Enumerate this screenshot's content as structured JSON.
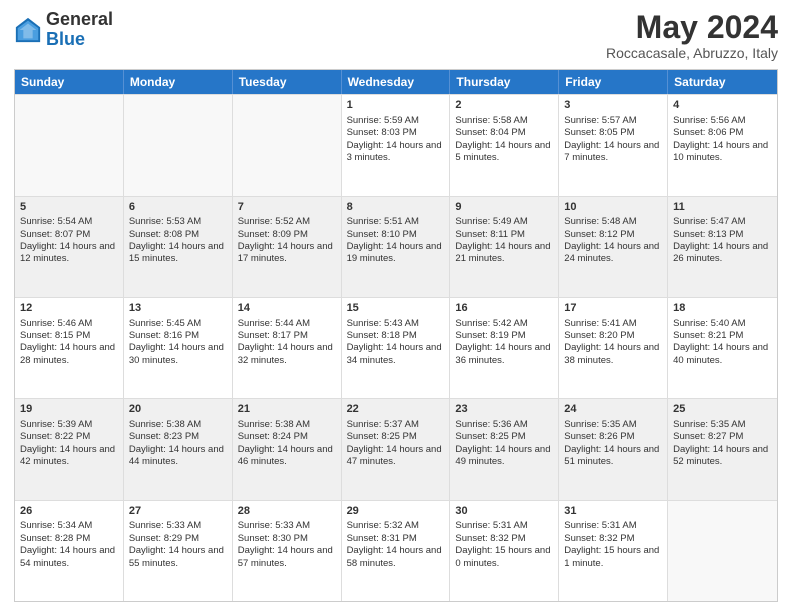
{
  "header": {
    "logo_line1": "General",
    "logo_line2": "Blue",
    "month": "May 2024",
    "location": "Roccacasale, Abruzzo, Italy"
  },
  "days": [
    "Sunday",
    "Monday",
    "Tuesday",
    "Wednesday",
    "Thursday",
    "Friday",
    "Saturday"
  ],
  "weeks": [
    [
      {
        "day": "",
        "empty": true
      },
      {
        "day": "",
        "empty": true
      },
      {
        "day": "",
        "empty": true
      },
      {
        "day": "1",
        "rise": "5:59 AM",
        "set": "8:03 PM",
        "daylight": "14 hours and 3 minutes."
      },
      {
        "day": "2",
        "rise": "5:58 AM",
        "set": "8:04 PM",
        "daylight": "14 hours and 5 minutes."
      },
      {
        "day": "3",
        "rise": "5:57 AM",
        "set": "8:05 PM",
        "daylight": "14 hours and 7 minutes."
      },
      {
        "day": "4",
        "rise": "5:56 AM",
        "set": "8:06 PM",
        "daylight": "14 hours and 10 minutes."
      }
    ],
    [
      {
        "day": "5",
        "rise": "5:54 AM",
        "set": "8:07 PM",
        "daylight": "14 hours and 12 minutes."
      },
      {
        "day": "6",
        "rise": "5:53 AM",
        "set": "8:08 PM",
        "daylight": "14 hours and 15 minutes."
      },
      {
        "day": "7",
        "rise": "5:52 AM",
        "set": "8:09 PM",
        "daylight": "14 hours and 17 minutes."
      },
      {
        "day": "8",
        "rise": "5:51 AM",
        "set": "8:10 PM",
        "daylight": "14 hours and 19 minutes."
      },
      {
        "day": "9",
        "rise": "5:49 AM",
        "set": "8:11 PM",
        "daylight": "14 hours and 21 minutes."
      },
      {
        "day": "10",
        "rise": "5:48 AM",
        "set": "8:12 PM",
        "daylight": "14 hours and 24 minutes."
      },
      {
        "day": "11",
        "rise": "5:47 AM",
        "set": "8:13 PM",
        "daylight": "14 hours and 26 minutes."
      }
    ],
    [
      {
        "day": "12",
        "rise": "5:46 AM",
        "set": "8:15 PM",
        "daylight": "14 hours and 28 minutes."
      },
      {
        "day": "13",
        "rise": "5:45 AM",
        "set": "8:16 PM",
        "daylight": "14 hours and 30 minutes."
      },
      {
        "day": "14",
        "rise": "5:44 AM",
        "set": "8:17 PM",
        "daylight": "14 hours and 32 minutes."
      },
      {
        "day": "15",
        "rise": "5:43 AM",
        "set": "8:18 PM",
        "daylight": "14 hours and 34 minutes."
      },
      {
        "day": "16",
        "rise": "5:42 AM",
        "set": "8:19 PM",
        "daylight": "14 hours and 36 minutes."
      },
      {
        "day": "17",
        "rise": "5:41 AM",
        "set": "8:20 PM",
        "daylight": "14 hours and 38 minutes."
      },
      {
        "day": "18",
        "rise": "5:40 AM",
        "set": "8:21 PM",
        "daylight": "14 hours and 40 minutes."
      }
    ],
    [
      {
        "day": "19",
        "rise": "5:39 AM",
        "set": "8:22 PM",
        "daylight": "14 hours and 42 minutes."
      },
      {
        "day": "20",
        "rise": "5:38 AM",
        "set": "8:23 PM",
        "daylight": "14 hours and 44 minutes."
      },
      {
        "day": "21",
        "rise": "5:38 AM",
        "set": "8:24 PM",
        "daylight": "14 hours and 46 minutes."
      },
      {
        "day": "22",
        "rise": "5:37 AM",
        "set": "8:25 PM",
        "daylight": "14 hours and 47 minutes."
      },
      {
        "day": "23",
        "rise": "5:36 AM",
        "set": "8:25 PM",
        "daylight": "14 hours and 49 minutes."
      },
      {
        "day": "24",
        "rise": "5:35 AM",
        "set": "8:26 PM",
        "daylight": "14 hours and 51 minutes."
      },
      {
        "day": "25",
        "rise": "5:35 AM",
        "set": "8:27 PM",
        "daylight": "14 hours and 52 minutes."
      }
    ],
    [
      {
        "day": "26",
        "rise": "5:34 AM",
        "set": "8:28 PM",
        "daylight": "14 hours and 54 minutes."
      },
      {
        "day": "27",
        "rise": "5:33 AM",
        "set": "8:29 PM",
        "daylight": "14 hours and 55 minutes."
      },
      {
        "day": "28",
        "rise": "5:33 AM",
        "set": "8:30 PM",
        "daylight": "14 hours and 57 minutes."
      },
      {
        "day": "29",
        "rise": "5:32 AM",
        "set": "8:31 PM",
        "daylight": "14 hours and 58 minutes."
      },
      {
        "day": "30",
        "rise": "5:31 AM",
        "set": "8:32 PM",
        "daylight": "15 hours and 0 minutes."
      },
      {
        "day": "31",
        "rise": "5:31 AM",
        "set": "8:32 PM",
        "daylight": "15 hours and 1 minute."
      },
      {
        "day": "",
        "empty": true
      }
    ]
  ]
}
